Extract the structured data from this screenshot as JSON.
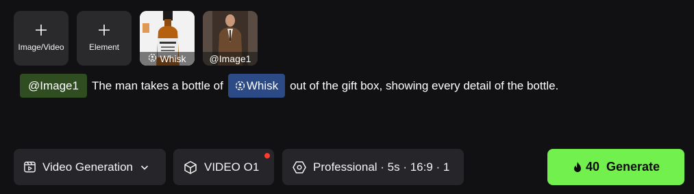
{
  "tiles": {
    "image_video_label": "Image/Video",
    "element_label": "Element",
    "bottle_caption": "Whisk",
    "man_caption": "@Image1"
  },
  "prompt": {
    "mention_image": "@Image1",
    "text_1": "The man  takes a bottle of",
    "mention_element": "Whisk",
    "text_2": "out of the gift box, showing every detail of the bottle."
  },
  "toolbar": {
    "mode_label": "Video Generation",
    "model_label": "VIDEO O1",
    "settings_label": "Professional · 5s · 16:9 · 1",
    "credits": "40",
    "generate_label": "Generate"
  },
  "colors": {
    "background": "#111113",
    "tile": "#2a2a2c",
    "image_mention": "#2f4d20",
    "element_mention": "#2c4a86",
    "generate": "#72f04e",
    "notification_dot": "#ff3b30"
  },
  "icons": [
    "plus-icon",
    "element-face-icon",
    "video-generation-icon",
    "chevron-down-icon",
    "cube-icon",
    "hexagon-settings-icon",
    "flame-icon"
  ]
}
